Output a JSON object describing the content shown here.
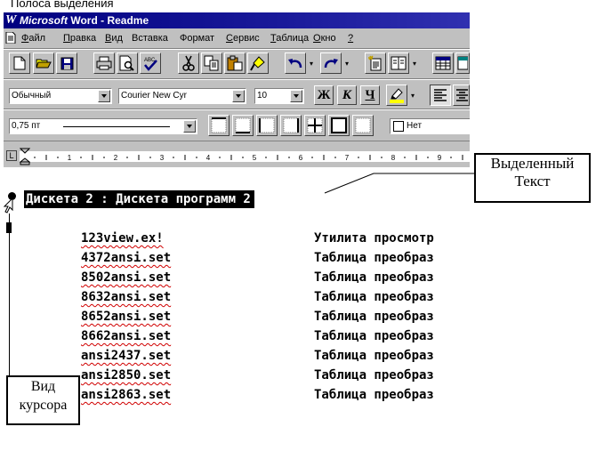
{
  "callouts": {
    "selection_strip": "Полоса выделения",
    "selected_text": [
      "Выделенный",
      "Текст"
    ],
    "cursor_view": [
      "Вид",
      "курсора"
    ]
  },
  "window": {
    "app_name": "Microsoft",
    "title_rest": " Word - Readme"
  },
  "menu": [
    {
      "label": "Файл",
      "key": "Ф",
      "rest": "айл"
    },
    {
      "label": "Правка",
      "key": "П",
      "rest": "равка"
    },
    {
      "label": "Вид",
      "key": "В",
      "rest": "ид"
    },
    {
      "label": "Вставка",
      "key": "",
      "rest": "Вставка"
    },
    {
      "label": "Формат",
      "key": "",
      "rest": "Формат"
    },
    {
      "label": "Сервис",
      "key": "С",
      "rest": "ервис"
    },
    {
      "label": "Таблица",
      "key": "Т",
      "rest": "аблица"
    },
    {
      "label": "Окно",
      "key": "О",
      "rest": "кно"
    },
    {
      "label": "?",
      "key": "?",
      "rest": ""
    }
  ],
  "formatting": {
    "style": "Обычный",
    "font": "Courier New Cyr",
    "size": "10",
    "bold": "Ж",
    "italic": "К",
    "underline": "Ч"
  },
  "borders": {
    "line_width": "0,75 пт",
    "shading": "Нет"
  },
  "ruler": {
    "numbers": [
      "1",
      "2",
      "3",
      "4",
      "5",
      "6",
      "7",
      "8",
      "9"
    ]
  },
  "document": {
    "selected_line": "Дискета 2 : Дискета программ 2",
    "rows": [
      {
        "file": "123view.ex!",
        "desc": "Утилита просмотр"
      },
      {
        "file": "4372ansi.set",
        "desc": "Таблица преобраз"
      },
      {
        "file": "8502ansi.set",
        "desc": "Таблица преобраз"
      },
      {
        "file": "8632ansi.set",
        "desc": "Таблица преобраз"
      },
      {
        "file": "8652ansi.set",
        "desc": "Таблица преобраз"
      },
      {
        "file": "8662ansi.set",
        "desc": "Таблица преобраз"
      },
      {
        "file": "ansi2437.set",
        "desc": "Таблица преобраз"
      },
      {
        "file": "ansi2850.set",
        "desc": "Таблица преобраз"
      },
      {
        "file": "ansi2863.set",
        "desc": "Таблица преобраз"
      }
    ]
  }
}
